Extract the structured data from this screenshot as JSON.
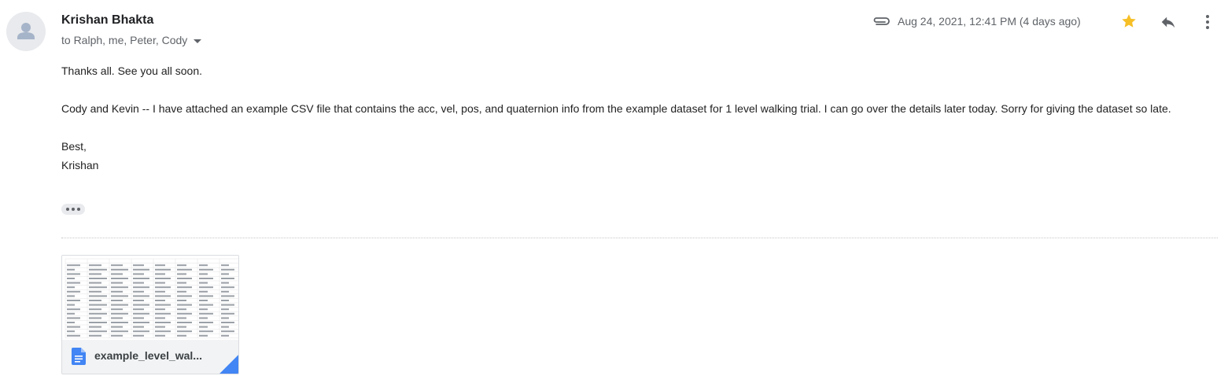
{
  "message": {
    "sender_name": "Krishan Bhakta",
    "recipients": "to Ralph, me, Peter, Cody",
    "date": "Aug 24, 2021, 12:41 PM (4 days ago)",
    "body": {
      "line1": "Thanks all. See you all soon.",
      "line2": "Cody and Kevin -- I have attached an example CSV file that contains the acc, vel, pos, and quaternion info from the example dataset for 1 level walking trial. I can go over the details later today. Sorry for giving the dataset so late.",
      "signoff": "Best,",
      "signature": "Krishan"
    }
  },
  "icons": {
    "avatar": "person-icon",
    "attachment": "paperclip-icon",
    "star": "star-icon",
    "reply": "reply-icon",
    "more": "more-vert-icon",
    "trimmed": "ellipsis-icon",
    "file": "google-docs-icon"
  },
  "attachment": {
    "name": "example_level_wal..."
  },
  "colors": {
    "star": "#f6bf26",
    "doc_icon": "#4285f4",
    "secondary_text": "#5f6368"
  }
}
